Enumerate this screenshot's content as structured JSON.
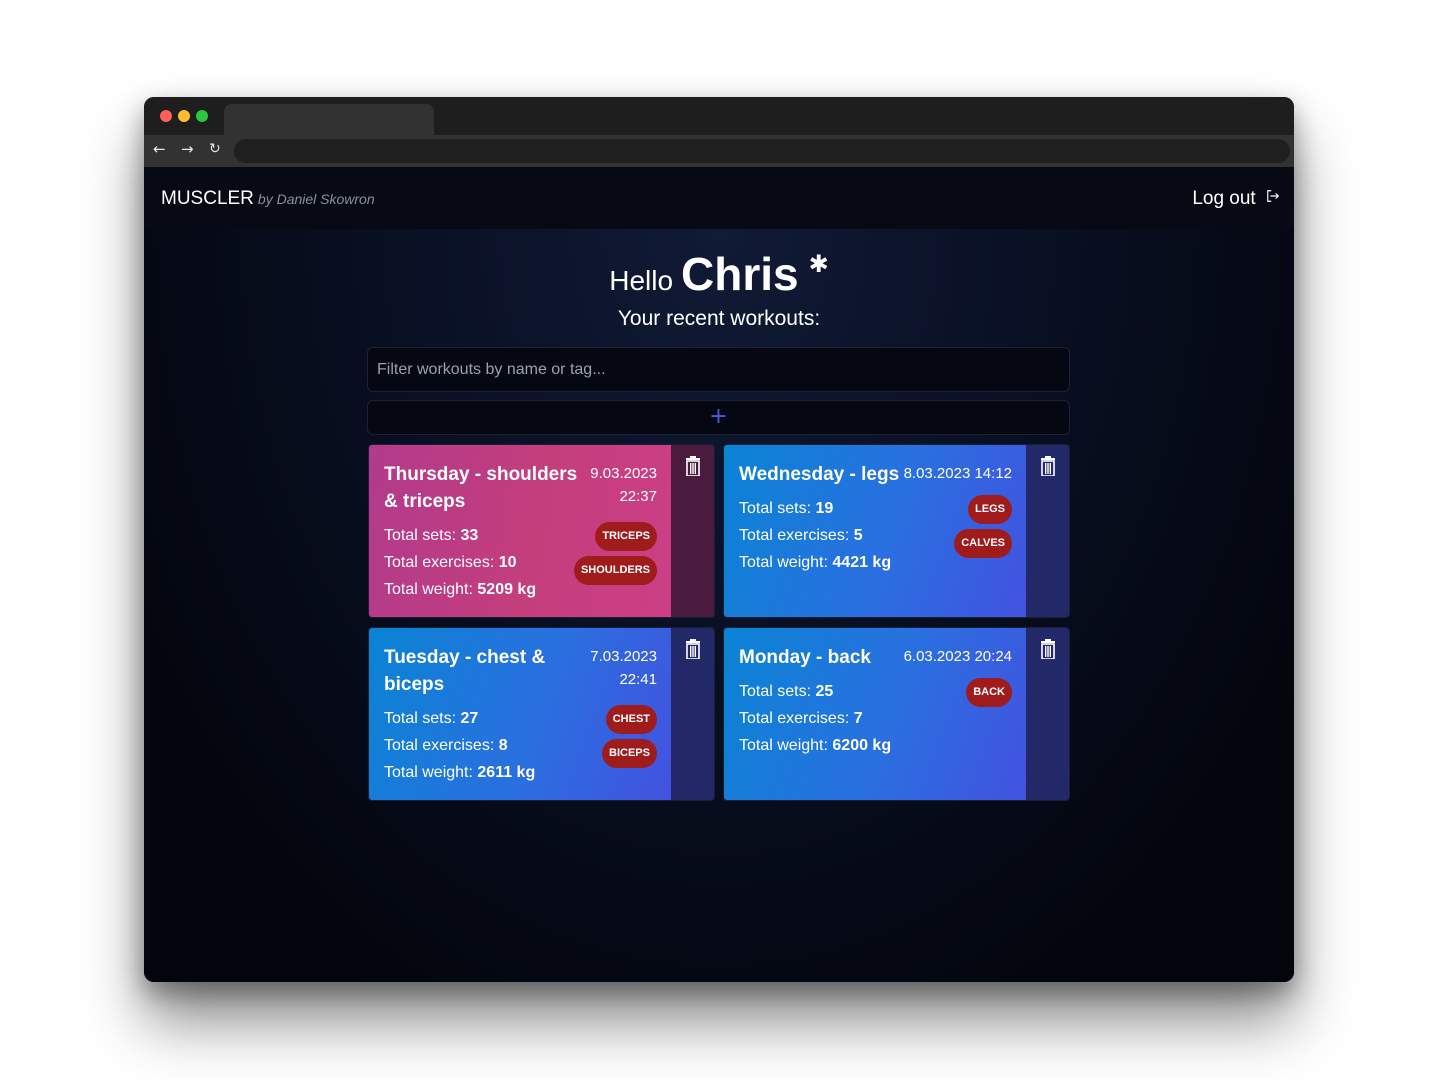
{
  "navbar": {
    "brand": "MUSCLER",
    "brand_by": "by Daniel Skowron",
    "logout_label": "Log out"
  },
  "greeting": {
    "hello": "Hello",
    "name": "Chris",
    "subtitle": "Your recent workouts:"
  },
  "filter": {
    "placeholder": "Filter workouts by name or tag..."
  },
  "add_button": "+",
  "labels": {
    "total_sets": "Total sets:",
    "total_exercises": "Total exercises:",
    "total_weight": "Total weight:"
  },
  "workouts": [
    {
      "title": "Thursday - shoulders & triceps",
      "date": "9.03.2023 22:37",
      "sets": "33",
      "exercises": "10",
      "weight": "5209 kg",
      "tags": [
        "TRICEPS",
        "SHOULDERS"
      ],
      "color": "pink"
    },
    {
      "title": "Wednesday - legs",
      "date": "8.03.2023 14:12",
      "sets": "19",
      "exercises": "5",
      "weight": "4421 kg",
      "tags": [
        "LEGS",
        "CALVES"
      ],
      "color": "blue"
    },
    {
      "title": "Tuesday - chest & biceps",
      "date": "7.03.2023 22:41",
      "sets": "27",
      "exercises": "8",
      "weight": "2611 kg",
      "tags": [
        "CHEST",
        "BICEPS"
      ],
      "color": "blue"
    },
    {
      "title": "Monday - back",
      "date": "6.03.2023 20:24",
      "sets": "25",
      "exercises": "7",
      "weight": "6200 kg",
      "tags": [
        "BACK"
      ],
      "color": "blue"
    }
  ]
}
